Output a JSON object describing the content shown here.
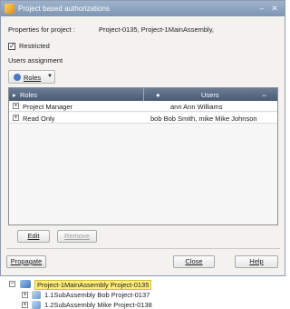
{
  "window": {
    "title": "Project based authorizations"
  },
  "properties": {
    "label": "Properties for project :",
    "value": "Project-0135, Project-1MainAssembly,"
  },
  "restricted": {
    "label": "Restricted",
    "checked": true
  },
  "users_assignment_label": "Users assignment",
  "roles_button": {
    "label": "Roles"
  },
  "grid": {
    "headers": {
      "roles": "Roles",
      "users": "Users"
    },
    "rows": [
      {
        "role": "Project Manager",
        "users": "ann Ann Williams"
      },
      {
        "role": "Read Only",
        "users": "bob Bob Smith,  mike Mike Johnson"
      }
    ]
  },
  "buttons": {
    "edit": "Edit",
    "remove": "Remove",
    "propagate": "Propagate",
    "close": "Close",
    "help": "Help"
  },
  "tree": {
    "items": [
      {
        "label": "Project-1MainAssembly Project-0135",
        "selected": true
      },
      {
        "label": "1.1SubAssembly Bob Project-0137",
        "selected": false
      },
      {
        "label": "1.2SubAssembly Mike Project-0138",
        "selected": false
      }
    ]
  },
  "colors": {
    "titlebar": "#8aa0bf",
    "grid_header": "#56667f",
    "tree_highlight": "#ffee7a"
  }
}
